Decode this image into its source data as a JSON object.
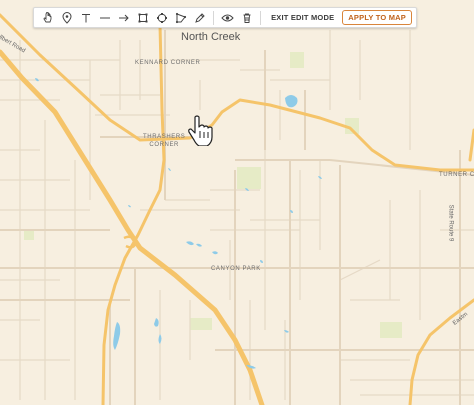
{
  "toolbar": {
    "tools": [
      {
        "icon": "hand-pointer-icon"
      },
      {
        "icon": "map-pin-icon"
      },
      {
        "icon": "text-icon"
      },
      {
        "icon": "line-icon"
      },
      {
        "icon": "arrow-icon"
      },
      {
        "icon": "rectangle-icon"
      },
      {
        "icon": "circle-icon"
      },
      {
        "icon": "polygon-icon"
      },
      {
        "icon": "pen-icon"
      },
      {
        "icon": "eye-icon"
      },
      {
        "icon": "trash-icon"
      }
    ],
    "exit_label": "EXIT EDIT MODE",
    "apply_label": "APPLY TO MAP",
    "apply_color": "#c0621c"
  },
  "map": {
    "city": "North Creek",
    "places": {
      "kennard": "KENNARD CORNER",
      "thrashers_1": "THRASHERS",
      "thrashers_2": "CORNER",
      "canyon": "CANYON PARK",
      "turner": "TURNER CO"
    },
    "roads": {
      "top_left": "ellbert Road",
      "state_route": "State Route 9",
      "bottom_right": "Eastm"
    },
    "colors": {
      "background": "#f7efe0",
      "highway": "#f5c46a",
      "water": "#8ecbe8",
      "park": "#e6ebc6"
    }
  }
}
